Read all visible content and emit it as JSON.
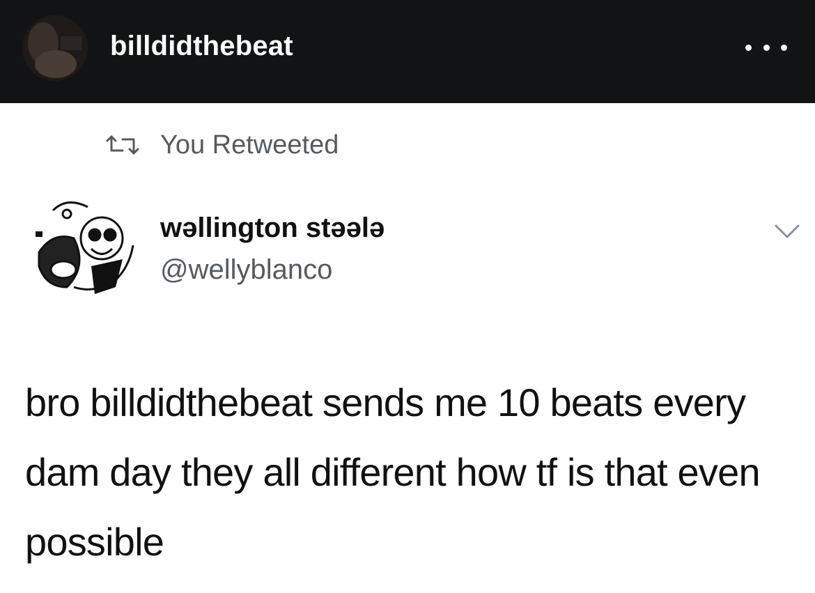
{
  "header": {
    "username": "billdidthebeat",
    "menu_icon": "more-dots-icon"
  },
  "retweet": {
    "label": "You Retweeted",
    "icon": "retweet-icon"
  },
  "tweet": {
    "display_name": "wəllington stəələ",
    "handle": "@wellyblanco",
    "text": "bro billdidthebeat sends me 10 beats every dam day they all different how tf is that even possible",
    "menu_icon": "chevron-down-icon"
  }
}
